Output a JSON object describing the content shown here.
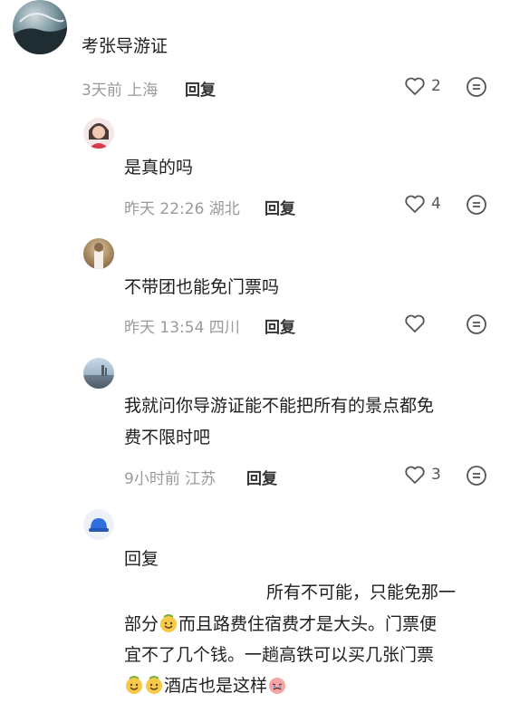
{
  "comments": [
    {
      "text": "考张导游证",
      "meta": "3天前 上海",
      "reply": "回复",
      "likes": "2"
    },
    {
      "text": "是真的吗",
      "meta": "昨天 22:26 湖北",
      "reply": "回复",
      "likes": "4"
    },
    {
      "text": "不带团也能免门票吗",
      "meta": "昨天 13:54 四川",
      "reply": "回复",
      "likes": ""
    },
    {
      "text_line1": "我就问你导游证能不能把所有的景点都免",
      "text_line2": "费不限时吧",
      "meta": "9小时前 江苏",
      "reply": "回复",
      "likes": "3"
    }
  ],
  "last": {
    "reply_prefix": "回复",
    "line1": "所有不可能，只能免那一",
    "line2a": "部分",
    "line2b": "而且路费住宿费才是大头。门票便",
    "line3": "宜不了几个钱。一趟高铁可以买几张门票",
    "line4": "酒店也是这样"
  },
  "icons": {
    "like": "heart-outline-icon",
    "more": "more-face-icon",
    "emoji_happy": "happy-face-emoji",
    "emoji_sad": "crying-face-emoji"
  },
  "colors": {
    "meta": "#9a9a9a",
    "text": "#1f1f1f",
    "accent": "#333333"
  }
}
